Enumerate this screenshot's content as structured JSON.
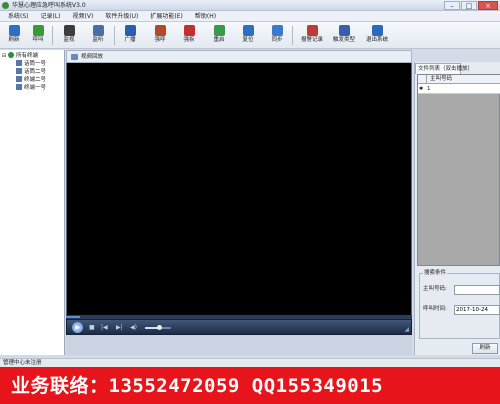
{
  "window": {
    "title": "华慧心理应急呼叫系统V3.0",
    "controls": {
      "minimize": "–",
      "maximize": "□",
      "close": "×"
    }
  },
  "menu": [
    "系统(S)",
    "记录(L)",
    "视频(V)",
    "软件升级(U)",
    "扩展功能(E)",
    "帮助(H)"
  ],
  "toolbar": {
    "items": [
      {
        "label": "刷新",
        "icon": "refresh-icon",
        "color": "#2f6fc0"
      },
      {
        "label": "呼叫",
        "icon": "call-icon",
        "color": "#3a9a3a"
      },
      {
        "label": "监视",
        "icon": "camera-icon",
        "color": "#3d3d3d"
      },
      {
        "label": "监听",
        "icon": "monitor-icon",
        "color": "#4a6fa8"
      },
      {
        "label": "广播",
        "icon": "broadcast-icon",
        "color": "#2a5fb0"
      },
      {
        "label": "强呼",
        "icon": "force-call-icon",
        "color": "#b0482a"
      },
      {
        "label": "强拆",
        "icon": "force-hangup-icon",
        "color": "#c23030"
      },
      {
        "label": "重启",
        "icon": "restart-icon",
        "color": "#3a9a4a"
      },
      {
        "label": "复位",
        "icon": "reset-icon",
        "color": "#2f6fc0"
      },
      {
        "label": "同步",
        "icon": "sync-icon",
        "color": "#3a7ac8"
      },
      {
        "label": "报警记录",
        "icon": "alarm-log-icon",
        "color": "#c03a3a"
      },
      {
        "label": "触发类型",
        "icon": "trigger-type-icon",
        "color": "#3a5fa8"
      },
      {
        "label": "退出系统",
        "icon": "exit-icon",
        "color": "#2a6ab8"
      }
    ]
  },
  "tree": {
    "root": "所有终端",
    "children": [
      "话筒一号",
      "话筒二号",
      "终端二号",
      "终端一号"
    ]
  },
  "video": {
    "header": "视频回放",
    "progress": 0.04,
    "volume": 0.55,
    "play_symbol": "▶",
    "control_symbols": [
      "■",
      "|◀",
      "▶|",
      "◀)"
    ]
  },
  "right_panel": {
    "tab_label": "文件列表（双击播放）",
    "grid": {
      "column": "主叫号码",
      "row_marker": "✱",
      "rows": [
        "1"
      ]
    },
    "query": {
      "legend": "搜索条件",
      "caller_label": "主叫号码:",
      "caller_value": "",
      "time_label": "呼叫时间:",
      "time_value": "2017-10-24"
    },
    "refresh_label": "刷新"
  },
  "statusbar": {
    "text": "管理中心未注册"
  },
  "banner": {
    "text": "业务联络：13552472059 QQ155349015"
  }
}
